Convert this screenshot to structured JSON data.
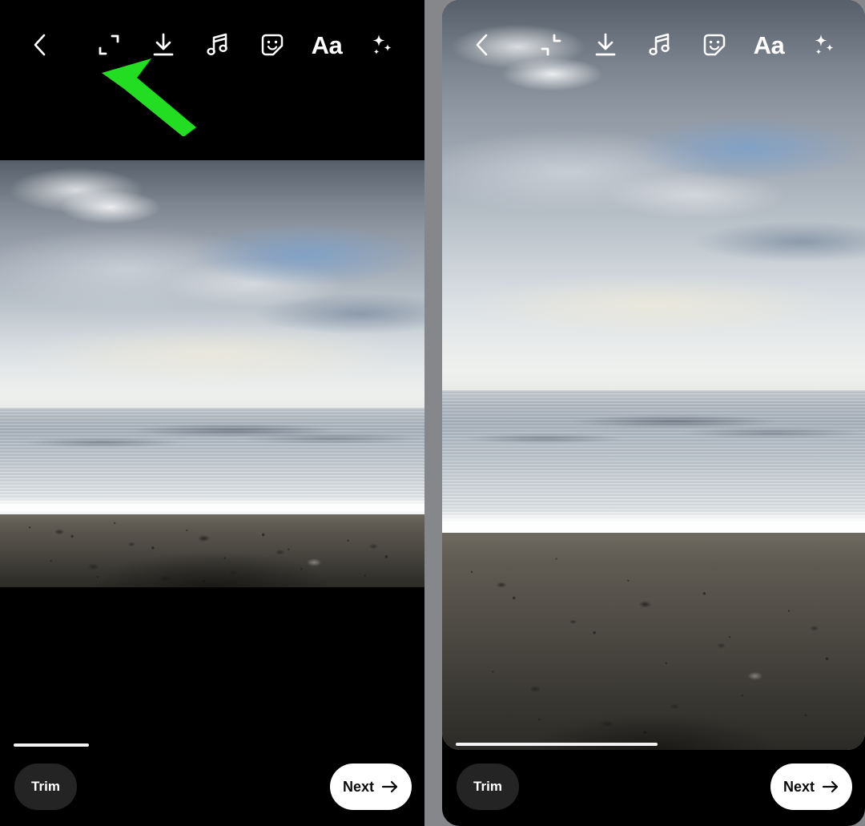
{
  "screenshot": {
    "type": "side-by-side-comparison",
    "divider_color": "#85878a",
    "background_color": "#000000",
    "accent_cursor_color": "#22dd22"
  },
  "panels": [
    {
      "id": "left",
      "name": "original-aspect-ratio-view",
      "media_fit": "fit",
      "letterboxed": true,
      "toolbar": {
        "back": {
          "label": "Back",
          "icon": "chevron-left-icon"
        },
        "aspect": {
          "label": "Expand to full screen",
          "icon": "expand-icon",
          "state": "expand"
        },
        "download": {
          "label": "Save",
          "icon": "download-icon"
        },
        "music": {
          "label": "Music",
          "icon": "music-note-icon"
        },
        "sticker": {
          "label": "Stickers",
          "icon": "sticker-smiley-icon"
        },
        "text": {
          "label": "Aa",
          "icon": "text-icon"
        },
        "effects": {
          "label": "Effects",
          "icon": "sparkles-icon"
        }
      },
      "bottom": {
        "trim_label": "Trim",
        "next_label": "Next",
        "next_icon": "arrow-right-icon",
        "progress_percent": 19
      }
    },
    {
      "id": "right",
      "name": "full-screen-aspect-ratio-view",
      "media_fit": "fill",
      "letterboxed": false,
      "toolbar": {
        "back": {
          "label": "Back",
          "icon": "chevron-left-icon"
        },
        "aspect": {
          "label": "Shrink to original size",
          "icon": "collapse-icon",
          "state": "collapse"
        },
        "download": {
          "label": "Save",
          "icon": "download-icon"
        },
        "music": {
          "label": "Music",
          "icon": "music-note-icon"
        },
        "sticker": {
          "label": "Stickers",
          "icon": "sticker-smiley-icon"
        },
        "text": {
          "label": "Aa",
          "icon": "text-icon"
        },
        "effects": {
          "label": "Effects",
          "icon": "sparkles-icon"
        }
      },
      "bottom": {
        "trim_label": "Trim",
        "next_label": "Next",
        "next_icon": "arrow-right-icon",
        "progress_percent": 51
      }
    }
  ],
  "annotation": {
    "cursor": {
      "name": "green-pointer-arrow",
      "color": "#22dd22",
      "points_at": "expand-icon",
      "direction": "up-left"
    }
  },
  "photo": {
    "subject": "Beach at dusk with cloudy sky, calm ocean and sand",
    "bands": [
      "sky",
      "sea",
      "foam",
      "sand"
    ]
  }
}
